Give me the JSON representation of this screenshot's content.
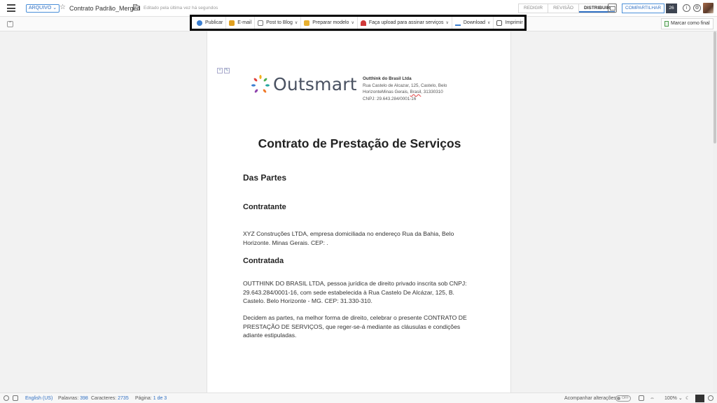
{
  "header": {
    "menu_label": "ARQUIVO",
    "document_title": "Contrato Padrão_Merged",
    "edited_status": "Editado pela última vez há segundos",
    "mode_tabs": [
      {
        "label": "REDIGIR"
      },
      {
        "label": "REVISÃO"
      },
      {
        "label": "DISTRIBUIR"
      }
    ],
    "share_label": "COMPARTILHAR",
    "dark_btn_label": "26"
  },
  "toolbar": {
    "items": [
      {
        "label": "Publicar",
        "icon": "globe-icon",
        "color": "#3b7fd1",
        "caret": false
      },
      {
        "label": "E-mail",
        "icon": "email-icon",
        "color": "#e0a020",
        "caret": false
      },
      {
        "label": "Post to Blog",
        "icon": "blog-icon",
        "color": "#8a8a8a",
        "caret": true
      },
      {
        "label": "Preparar modelo",
        "icon": "template-icon",
        "color": "#e8b030",
        "caret": true
      },
      {
        "label": "Faça upload para assinar serviços",
        "icon": "signature-icon",
        "color": "#d03a3a",
        "caret": true
      },
      {
        "label": "Download",
        "icon": "download-icon",
        "color": "#3b7fd1",
        "caret": true
      },
      {
        "label": "Imprimir",
        "icon": "print-icon",
        "color": "#555555",
        "caret": false
      }
    ],
    "caret": "∨",
    "mark_final_label": "Marcar como final"
  },
  "document": {
    "logo_text": "Outsmart",
    "company": {
      "name": "Outthink do Brasil Ltda",
      "line1": "Rua Castelo de Alcazar, 125, Castelo, Belo",
      "line2_a": "HorizonteMinas Gerais",
      "line2_b": ", ",
      "line2_c": "Brasil",
      "line2_d": ", 31330310",
      "line3": "CNPJ: 29.643.284/0001-16"
    },
    "title": "Contrato de Prestação de Serviços",
    "section1": "Das Partes",
    "contratante_heading": "Contratante",
    "contratante_text": "XYZ Construções LTDA, empresa domiciliada no endereço Rua da Bahia, Belo Horizonte. Minas Gerais. CEP: .",
    "contratada_heading": "Contratada",
    "contratada_text": "OUTTHINK DO BRASIL LTDA, pessoa jurídica de direito privado inscrita sob CNPJ: 29.643.284/0001-16, com sede estabelecida à Rua Castelo De Alcázar, 125, B. Castelo. Belo Horizonte - MG. CEP: 31.330-310.",
    "decidem_text": "Decidem as partes, na melhor forma de direito, celebrar o presente CONTRATO DE PRESTAÇÃO DE SERVIÇOS, que reger-se-á mediante as cláusulas e condições adiante estipuladas."
  },
  "status": {
    "language": "English (US)",
    "words_label": "Palavras:",
    "words": "398",
    "chars_label": "Caracteres:",
    "chars": "2735",
    "page_label": "Página:",
    "page_current": "1",
    "page_of": "de 3",
    "track_changes": "Acompanhar alterações",
    "toggle_state": "OFF",
    "zoom": "100%"
  }
}
